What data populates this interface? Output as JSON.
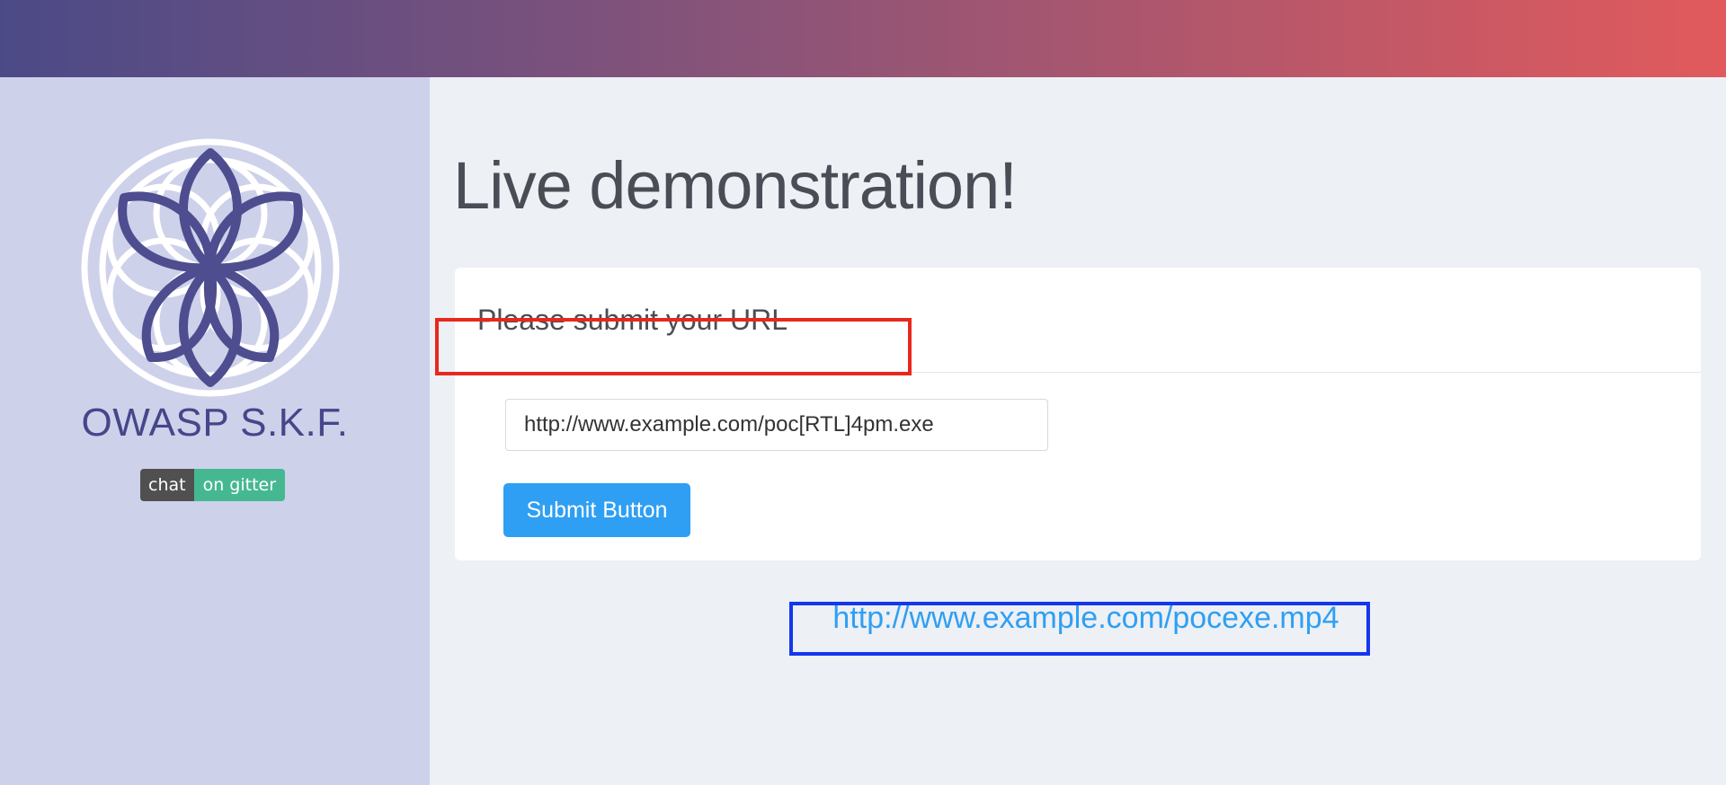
{
  "sidebar": {
    "brand": "OWASP S.K.F.",
    "gitter_badge": {
      "left_label": "chat",
      "right_label": "on gitter"
    }
  },
  "main": {
    "title": "Live demonstration!",
    "card": {
      "title": "Please submit your URL",
      "url_input_value": "http://www.example.com/poc[RTL]4pm.exe",
      "submit_label": "Submit Button"
    },
    "result_link": "http://www.example.com/pocexe.mp4"
  },
  "colors": {
    "header_gradient_start": "#4b4a87",
    "header_gradient_end": "#e15a5c",
    "sidebar_bg": "#ced1ea",
    "brand_color": "#46468a",
    "accent_blue": "#2f9ff3",
    "highlight_red": "#e8281e",
    "highlight_blue": "#1537ee"
  }
}
